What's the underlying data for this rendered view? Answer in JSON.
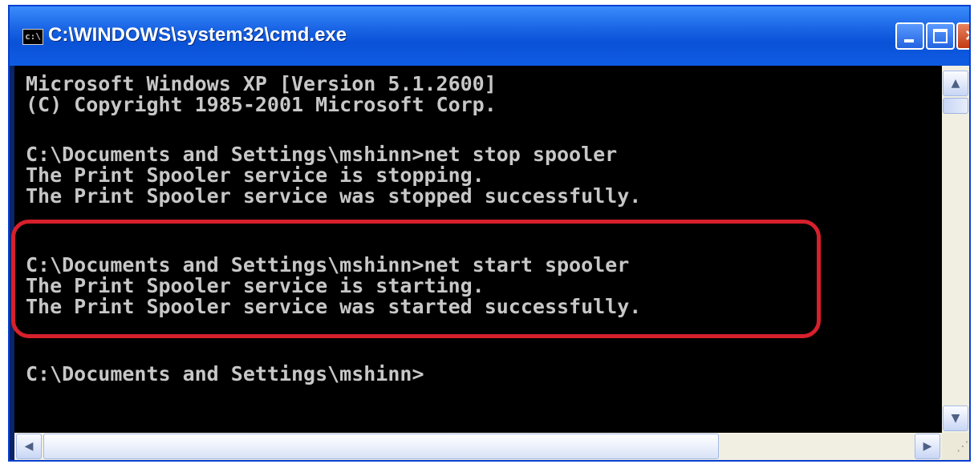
{
  "window": {
    "title": "C:\\WINDOWS\\system32\\cmd.exe",
    "icon_label": "c:\\"
  },
  "titlebar_buttons": {
    "close_glyph": "×"
  },
  "console": {
    "lines": [
      "Microsoft Windows XP [Version 5.1.2600]",
      "(C) Copyright 1985-2001 Microsoft Corp.",
      "",
      "C:\\Documents and Settings\\mshinn>net stop spooler",
      "The Print Spooler service is stopping.",
      "The Print Spooler service was stopped successfully.",
      "",
      "",
      "C:\\Documents and Settings\\mshinn>net start spooler",
      "The Print Spooler service is starting.",
      "The Print Spooler service was started successfully.",
      "",
      "",
      "C:\\Documents and Settings\\mshinn>"
    ],
    "text_color": "#c7c7c7",
    "background": "#000000"
  },
  "annotation": {
    "highlight_color": "#d6202c"
  },
  "scrollbars": {
    "up_arrow": "▲",
    "down_arrow": "▼",
    "left_arrow": "◀",
    "right_arrow": "▶"
  },
  "resize_grip": "⋰"
}
